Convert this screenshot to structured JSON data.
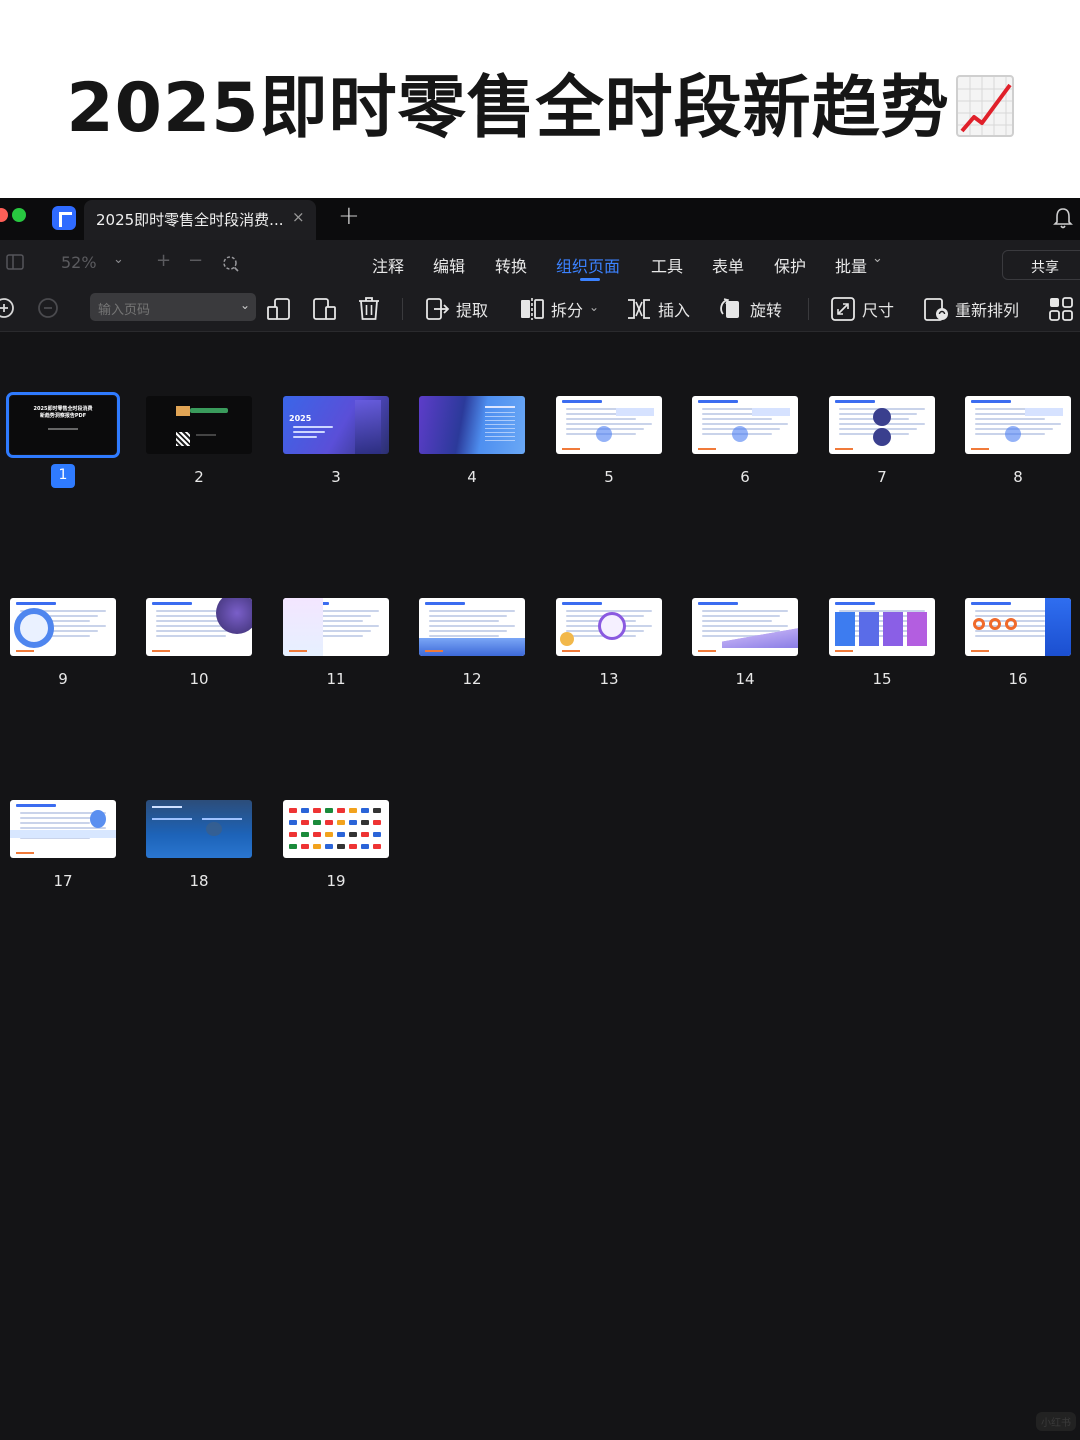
{
  "banner": {
    "title": "2025即时零售全时段新趋势",
    "emoji": "chart-increasing-emoji"
  },
  "tab": {
    "title": "2025即时零售全时段消费...",
    "close": "×",
    "new_tab": "+"
  },
  "menu": {
    "zoom": "52%",
    "items": [
      "注释",
      "编辑",
      "转换",
      "组织页面",
      "工具",
      "表单",
      "保护",
      "批量"
    ],
    "active": "组织页面",
    "share": "共享"
  },
  "toolbar": {
    "page_input_placeholder": "输入页码",
    "extract": "提取",
    "split": "拆分",
    "insert": "插入",
    "rotate": "旋转",
    "size": "尺寸",
    "reorder": "重新排列"
  },
  "pages": [
    {
      "label": "1",
      "theme": "black",
      "selected": true
    },
    {
      "label": "2",
      "theme": "black-qr"
    },
    {
      "label": "3",
      "theme": "blue-purple-cover"
    },
    {
      "label": "4",
      "theme": "blue-building"
    },
    {
      "label": "5",
      "theme": "white-blue"
    },
    {
      "label": "6",
      "theme": "white-blue"
    },
    {
      "label": "7",
      "theme": "white-dark-circles"
    },
    {
      "label": "8",
      "theme": "white-blue"
    },
    {
      "label": "9",
      "theme": "white-circle"
    },
    {
      "label": "10",
      "theme": "white-purple"
    },
    {
      "label": "11",
      "theme": "white-pink"
    },
    {
      "label": "12",
      "theme": "white-blue-bottom"
    },
    {
      "label": "13",
      "theme": "white-purple-circle"
    },
    {
      "label": "14",
      "theme": "white-wave"
    },
    {
      "label": "15",
      "theme": "white-cards"
    },
    {
      "label": "16",
      "theme": "white-orange-rings"
    },
    {
      "label": "17",
      "theme": "white-mascot"
    },
    {
      "label": "18",
      "theme": "dark-blue"
    },
    {
      "label": "19",
      "theme": "white-logos"
    }
  ],
  "page1_text": {
    "line1": "2025即时零售全时段消费",
    "line2": "新趋势洞察报告PDF"
  },
  "page3_text": {
    "year": "2025"
  },
  "watermark": "小红书",
  "colors": {
    "accent": "#2f7bff",
    "bg": "#141416",
    "active_menu": "#3b82ff"
  }
}
